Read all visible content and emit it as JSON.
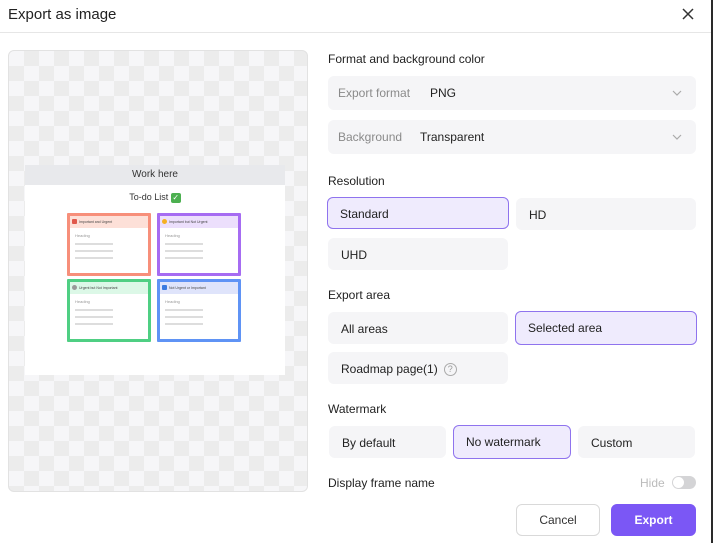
{
  "dialog": {
    "title": "Export as image",
    "close_icon": "close-icon"
  },
  "preview": {
    "frame_name": "Work here",
    "board_title": "To-do List",
    "board_title_emoji": "✓",
    "quadrants": [
      {
        "label": "Important and Urgent",
        "heading": "Heading",
        "color": "#f78f7a",
        "header_bg": "#fde0d8"
      },
      {
        "label": "Important but Not Urgent",
        "heading": "Heading",
        "color": "#a66cf2",
        "header_bg": "#ecdffc"
      },
      {
        "label": "Urgent but Not Important",
        "heading": "Heading",
        "color": "#4fcf83",
        "header_bg": "#dcf8e7"
      },
      {
        "label": "Not Urgent or Important",
        "heading": "Heading",
        "color": "#5f93f5",
        "header_bg": "#dfe4fb"
      }
    ]
  },
  "format_section": {
    "label": "Format and background color",
    "export_format": {
      "label": "Export format",
      "value": "PNG"
    },
    "background": {
      "label": "Background",
      "value": "Transparent"
    }
  },
  "resolution": {
    "label": "Resolution",
    "options": [
      {
        "label": "Standard",
        "selected": true
      },
      {
        "label": "HD",
        "selected": false
      },
      {
        "label": "UHD",
        "selected": false
      }
    ]
  },
  "export_area": {
    "label": "Export area",
    "options": [
      {
        "label": "All areas",
        "selected": false
      },
      {
        "label": "Selected area",
        "selected": true
      },
      {
        "label": "Roadmap page(1)",
        "selected": false,
        "help": "?"
      }
    ]
  },
  "watermark": {
    "label": "Watermark",
    "options": [
      {
        "label": "By default",
        "selected": false
      },
      {
        "label": "No watermark",
        "selected": true
      },
      {
        "label": "Custom",
        "selected": false
      }
    ]
  },
  "frame_name": {
    "label": "Display frame name",
    "toggle_label": "Hide",
    "enabled": false
  },
  "actions": {
    "cancel": "Cancel",
    "export": "Export"
  },
  "colors": {
    "accent": "#7b57f5",
    "selected_bg": "#efebfd",
    "selected_border": "#8f73ee"
  }
}
